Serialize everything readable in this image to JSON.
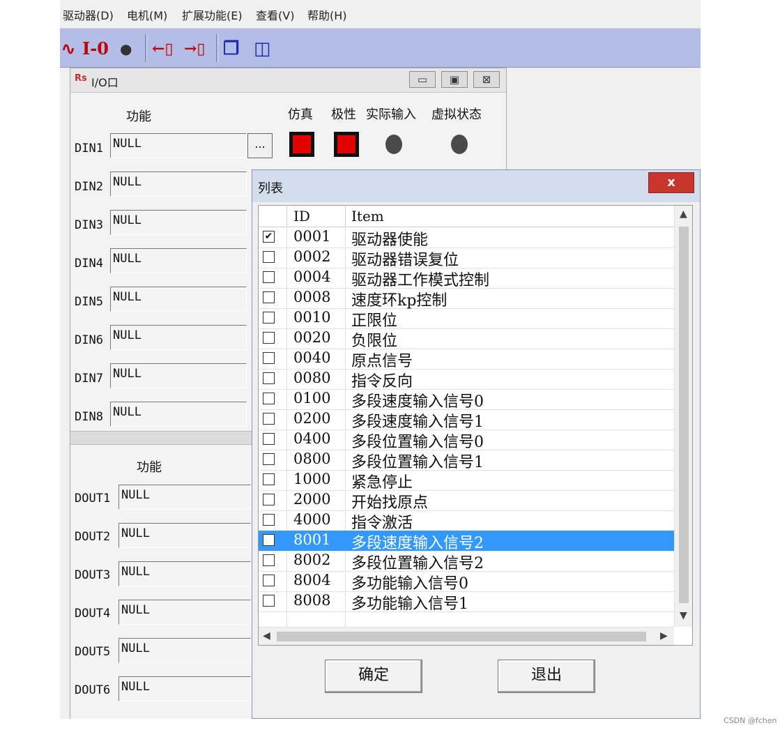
{
  "menu": [
    "驱动器(D)",
    "电机(M)",
    "扩展功能(E)",
    "查看(V)",
    "帮助(H)"
  ],
  "toolbar": {
    "io_label": "I-0"
  },
  "io_window": {
    "title": "I/O口",
    "input_header": {
      "function": "功能",
      "simulate": "仿真",
      "polarity": "极性",
      "actual_input": "实际输入",
      "virtual_state": "虚拟状态"
    },
    "browse_label": "...",
    "inputs": [
      {
        "label": "DIN1",
        "value": "NULL"
      },
      {
        "label": "DIN2",
        "value": "NULL"
      },
      {
        "label": "DIN3",
        "value": "NULL"
      },
      {
        "label": "DIN4",
        "value": "NULL"
      },
      {
        "label": "DIN5",
        "value": "NULL"
      },
      {
        "label": "DIN6",
        "value": "NULL"
      },
      {
        "label": "DIN7",
        "value": "NULL"
      },
      {
        "label": "DIN8",
        "value": "NULL"
      }
    ],
    "output_header": {
      "function": "功能"
    },
    "outputs": [
      {
        "label": "DOUT1",
        "value": "NULL"
      },
      {
        "label": "DOUT2",
        "value": "NULL"
      },
      {
        "label": "DOUT3",
        "value": "NULL"
      },
      {
        "label": "DOUT4",
        "value": "NULL"
      },
      {
        "label": "DOUT5",
        "value": "NULL"
      },
      {
        "label": "DOUT6",
        "value": "NULL"
      }
    ]
  },
  "dialog": {
    "title": "列表",
    "close_label": "x",
    "columns": {
      "id": "ID",
      "item": "Item"
    },
    "rows": [
      {
        "id": "0001",
        "item": "驱动器使能",
        "checked": true
      },
      {
        "id": "0002",
        "item": "驱动器错误复位",
        "checked": false
      },
      {
        "id": "0004",
        "item": "驱动器工作模式控制",
        "checked": false
      },
      {
        "id": "0008",
        "item": "速度环kp控制",
        "checked": false
      },
      {
        "id": "0010",
        "item": "正限位",
        "checked": false
      },
      {
        "id": "0020",
        "item": "负限位",
        "checked": false
      },
      {
        "id": "0040",
        "item": "原点信号",
        "checked": false
      },
      {
        "id": "0080",
        "item": "指令反向",
        "checked": false
      },
      {
        "id": "0100",
        "item": "多段速度输入信号0",
        "checked": false
      },
      {
        "id": "0200",
        "item": "多段速度输入信号1",
        "checked": false
      },
      {
        "id": "0400",
        "item": "多段位置输入信号0",
        "checked": false
      },
      {
        "id": "0800",
        "item": "多段位置输入信号1",
        "checked": false
      },
      {
        "id": "1000",
        "item": "紧急停止",
        "checked": false
      },
      {
        "id": "2000",
        "item": "开始找原点",
        "checked": false
      },
      {
        "id": "4000",
        "item": "指令激活",
        "checked": false
      },
      {
        "id": "8001",
        "item": "多段速度输入信号2",
        "checked": false,
        "selected": true
      },
      {
        "id": "8002",
        "item": "多段位置输入信号2",
        "checked": false
      },
      {
        "id": "8004",
        "item": "多功能输入信号0",
        "checked": false
      },
      {
        "id": "8008",
        "item": "多功能输入信号1",
        "checked": false
      }
    ],
    "confirm_label": "确定",
    "exit_label": "退出"
  },
  "watermark": "CSDN @fchen",
  "colors": {
    "toolbar": "#b4bde6",
    "selection": "#3399ff",
    "close_button": "#c8352c",
    "sim_red": "#e00000"
  }
}
